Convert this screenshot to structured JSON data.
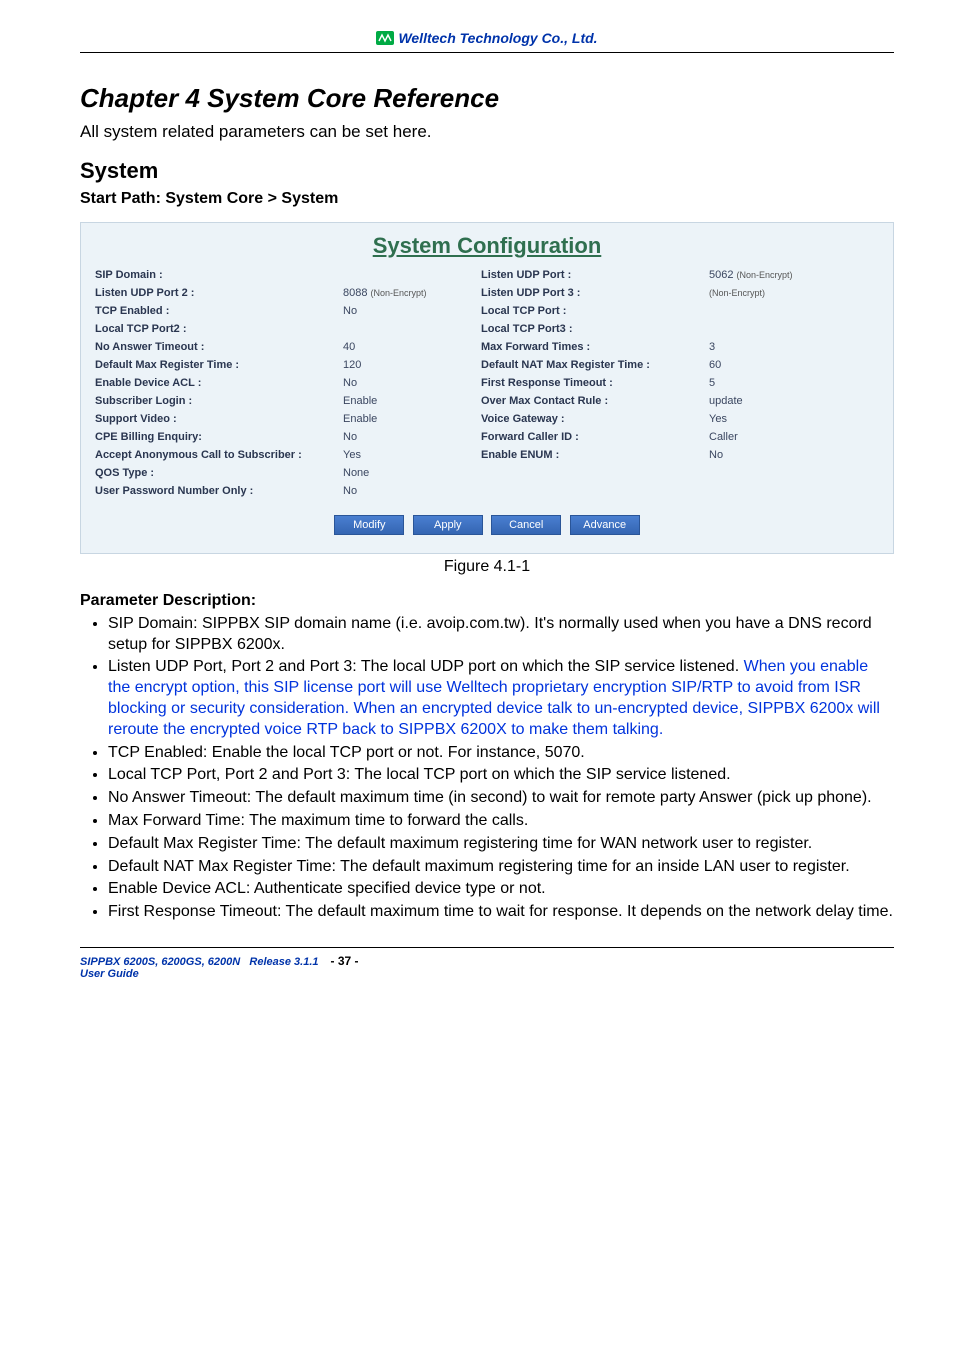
{
  "header": {
    "company": "Welltech Technology Co., Ltd."
  },
  "chapter": {
    "title": "Chapter 4 System Core Reference",
    "intro": "All system related parameters can be set here.",
    "section": "System",
    "startpath": "Start Path: System Core > System"
  },
  "config": {
    "title": "System Configuration",
    "rows": [
      [
        "SIP Domain :",
        "",
        "Listen UDP Port :",
        "5062",
        "(Non-Encrypt)"
      ],
      [
        "Listen UDP Port 2 :",
        "8088",
        "Listen UDP Port 3 :",
        "",
        "(Non-Encrypt)"
      ],
      [
        "TCP Enabled :",
        "No",
        "Local TCP Port :",
        "",
        ""
      ],
      [
        "Local TCP Port2 :",
        "",
        "Local TCP Port3 :",
        "",
        ""
      ],
      [
        "No Answer Timeout :",
        "40",
        "Max Forward Times :",
        "3",
        ""
      ],
      [
        "Default Max Register Time :",
        "120",
        "Default NAT Max Register Time :",
        "60",
        ""
      ],
      [
        "Enable Device ACL :",
        "No",
        "First Response Timeout :",
        "5",
        ""
      ],
      [
        "Subscriber Login :",
        "Enable",
        "Over Max Contact Rule :",
        "update",
        ""
      ],
      [
        "Support Video :",
        "Enable",
        "Voice Gateway :",
        "Yes",
        ""
      ],
      [
        "CPE Billing Enquiry:",
        "No",
        "Forward Caller ID :",
        "Caller",
        ""
      ],
      [
        "Accept Anonymous Call to Subscriber :",
        "Yes",
        "Enable ENUM :",
        "No",
        ""
      ],
      [
        "QOS Type :",
        "None",
        "",
        "",
        ""
      ],
      [
        "User Password Number Only :",
        "No",
        "",
        "",
        ""
      ]
    ],
    "row1_note": "(Non-Encrypt)",
    "buttons": [
      "Modify",
      "Apply",
      "Cancel",
      "Advance"
    ],
    "figure": "Figure 4.1-1"
  },
  "param": {
    "title": "Parameter Description:",
    "items": {
      "sip_domain": "SIP Domain: SIPPBX SIP domain name (i.e. avoip.com.tw). It's normally used when you have a DNS record setup for SIPPBX 6200x.",
      "listen_udp_pre": "Listen UDP Port, Port 2 and Port 3: The local UDP port on which the SIP service listened. ",
      "listen_udp_blue": "When you enable the encrypt option, this SIP license port will use Welltech proprietary encryption SIP/RTP to avoid from ISR blocking or security consideration. When an encrypted device talk to un-encrypted device, SIPPBX 6200x will reroute the encrypted voice RTP back to SIPPBX 6200X to make them talking.",
      "tcp_enabled": "TCP Enabled: Enable the local TCP port or not. For instance, 5070.",
      "local_tcp": "Local TCP Port, Port 2 and Port 3: The local TCP port on which the SIP service listened.",
      "no_answer": "No Answer Timeout: The default maximum time (in second) to wait for remote party Answer (pick up phone).",
      "max_fwd": "Max Forward Time: The maximum time to forward the calls.",
      "def_max_reg": "Default Max Register Time: The default maximum registering time for WAN network user to register.",
      "def_nat_max": "Default NAT Max Register Time: The default maximum registering time for an inside LAN user to register.",
      "enable_acl": "Enable Device ACL: Authenticate specified device type or not.",
      "first_resp": "First Response Timeout: The default maximum time to wait for response. It depends on the network delay time."
    }
  },
  "footer": {
    "left1": "SIPPBX 6200S, 6200GS, 6200N",
    "left2": "Release 3.1.1",
    "left3": "User Guide",
    "page": "- 37 -"
  }
}
